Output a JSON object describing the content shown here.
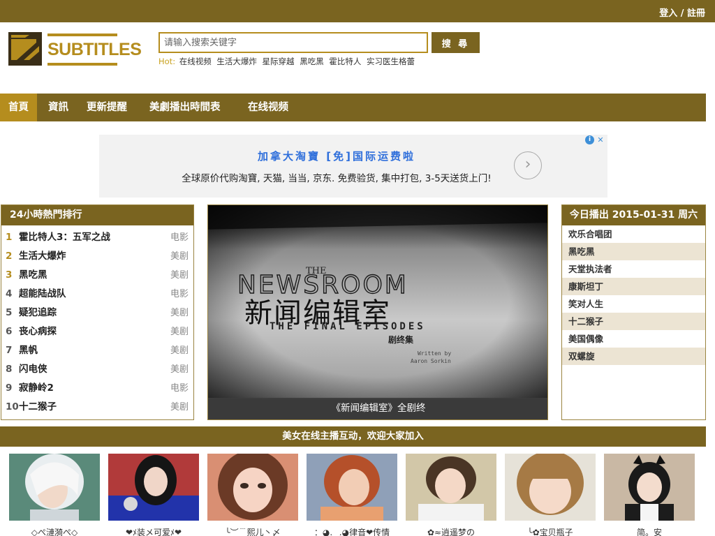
{
  "header": {
    "login_label": "登入 / 註冊"
  },
  "logo": {
    "text": "SUBTITLES"
  },
  "search": {
    "placeholder": "请输入搜索关键字",
    "button_label": "搜 尋"
  },
  "hot": {
    "label": "Hot:",
    "items": [
      "在线视频",
      "生活大爆炸",
      "星际穿越",
      "黑吃黑",
      "霍比特人",
      "实习医生格蕾"
    ]
  },
  "nav": {
    "items": [
      {
        "label": "首頁",
        "active": true
      },
      {
        "label": "資訊"
      },
      {
        "label": "更新提醒"
      },
      {
        "label": "美劇播出時間表"
      },
      {
        "label": "在线视频"
      }
    ]
  },
  "ad": {
    "title": "加拿大淘寶 [免]国际运费啦",
    "description": "全球原价代购淘寶, 天猫, 当当, 京东. 免费验货, 集中打包, 3-5天送货上门!"
  },
  "rank": {
    "title": "24小時熱門排行",
    "items": [
      {
        "num": "1",
        "title": "霍比特人3：五军之战",
        "type": "电影"
      },
      {
        "num": "2",
        "title": "生活大爆炸",
        "type": "美剧"
      },
      {
        "num": "3",
        "title": "黑吃黑",
        "type": "美剧"
      },
      {
        "num": "4",
        "title": "超能陆战队",
        "type": "电影"
      },
      {
        "num": "5",
        "title": "疑犯追踪",
        "type": "美剧"
      },
      {
        "num": "6",
        "title": "丧心病探",
        "type": "美剧"
      },
      {
        "num": "7",
        "title": "黑帆",
        "type": "美剧"
      },
      {
        "num": "8",
        "title": "闪电侠",
        "type": "美剧"
      },
      {
        "num": "9",
        "title": "寂静岭2",
        "type": "电影"
      },
      {
        "num": "10",
        "title": "十二猴子",
        "type": "美剧"
      }
    ]
  },
  "feature": {
    "caption": "《新闻编辑室》全剧终",
    "poster_the": "THE",
    "poster_title": "NEWSROOM",
    "poster_cn": "新闻编辑室",
    "poster_sub": "THE FINAL EPISODES",
    "poster_cn_sub": "剧终集",
    "poster_written": "Written by",
    "poster_author": "Aaron Sorkin"
  },
  "today": {
    "title": "今日播出 2015-01-31 周六",
    "items": [
      "欢乐合唱团",
      "黑吃黑",
      "天堂执法者",
      "康斯坦丁",
      "笑对人生",
      "十二猴子",
      "美国偶像",
      "双螺旋"
    ]
  },
  "live": {
    "title": "美女在线主播互动，欢迎大家加入",
    "hosts": [
      "◇ぺ漣漪ぺ◇",
      "❤ﾒ装メ可爱ﾒ❤",
      "╰︶﹉熙儿丶〆",
      "：◕.‿.◕律音❤传情",
      "✿≈逍遥梦の",
      "╰✿宝贝瓶子",
      "简。安"
    ]
  },
  "colors": {
    "brand": "#7a6420",
    "accent": "#b58d1e",
    "ad_link": "#2f6fdb",
    "alt_row": "#ece4d3"
  }
}
